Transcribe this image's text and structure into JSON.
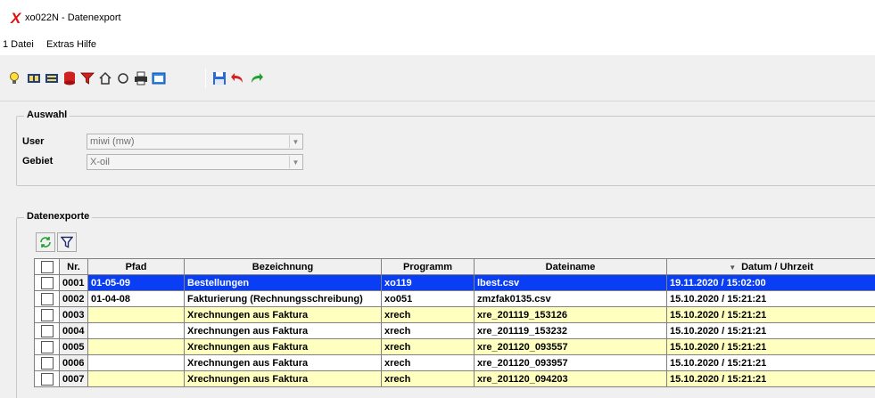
{
  "window": {
    "title": "xo022N - Datenexport"
  },
  "menu": {
    "items": [
      "1 Datei",
      "Extras",
      "Hilfe"
    ]
  },
  "toolbar": {
    "icons": [
      "lightbulb-icon",
      "book-open-icon",
      "book-icon",
      "database-icon",
      "filter-icon",
      "home-icon",
      "refresh-icon",
      "print-icon",
      "window-icon",
      "save-icon",
      "undo-icon",
      "redo-icon"
    ]
  },
  "auswahl": {
    "title": "Auswahl",
    "user_label": "User",
    "user_value": "miwi (mw)",
    "gebiet_label": "Gebiet",
    "gebiet_value": "X-oil"
  },
  "exporte": {
    "title": "Datenexporte",
    "columns": [
      "Nr.",
      "Pfad",
      "Bezeichnung",
      "Programm",
      "Dateiname",
      "Datum / Uhrzeit"
    ],
    "sorted_column": "Datum / Uhrzeit",
    "rows": [
      {
        "nr": "0001",
        "pfad": "01-05-09",
        "bez": "Bestellungen",
        "prog": "xo119",
        "datei": "lbest.csv",
        "datum": "19.11.2020 / 15:02:00",
        "style": "selected"
      },
      {
        "nr": "0002",
        "pfad": "01-04-08",
        "bez": "Fakturierung (Rechnungsschreibung)",
        "prog": "xo051",
        "datei": "zmzfak0135.csv",
        "datum": "15.10.2020 / 15:21:21",
        "style": "white"
      },
      {
        "nr": "0003",
        "pfad": "",
        "bez": "Xrechnungen aus Faktura",
        "prog": "xrech",
        "datei": "xre_201119_153126",
        "datum": "15.10.2020 / 15:21:21",
        "style": "yellow"
      },
      {
        "nr": "0004",
        "pfad": "",
        "bez": "Xrechnungen aus Faktura",
        "prog": "xrech",
        "datei": "xre_201119_153232",
        "datum": "15.10.2020 / 15:21:21",
        "style": "white"
      },
      {
        "nr": "0005",
        "pfad": "",
        "bez": "Xrechnungen aus Faktura",
        "prog": "xrech",
        "datei": "xre_201120_093557",
        "datum": "15.10.2020 / 15:21:21",
        "style": "yellow"
      },
      {
        "nr": "0006",
        "pfad": "",
        "bez": "Xrechnungen aus Faktura",
        "prog": "xrech",
        "datei": "xre_201120_093957",
        "datum": "15.10.2020 / 15:21:21",
        "style": "white"
      },
      {
        "nr": "0007",
        "pfad": "",
        "bez": "Xrechnungen aus Faktura",
        "prog": "xrech",
        "datei": "xre_201120_094203",
        "datum": "15.10.2020 / 15:21:21",
        "style": "yellow"
      }
    ]
  },
  "colors": {
    "selected": "#0a3ef5",
    "yellow_row": "#ffffc0",
    "accent_red": "#e01010"
  }
}
